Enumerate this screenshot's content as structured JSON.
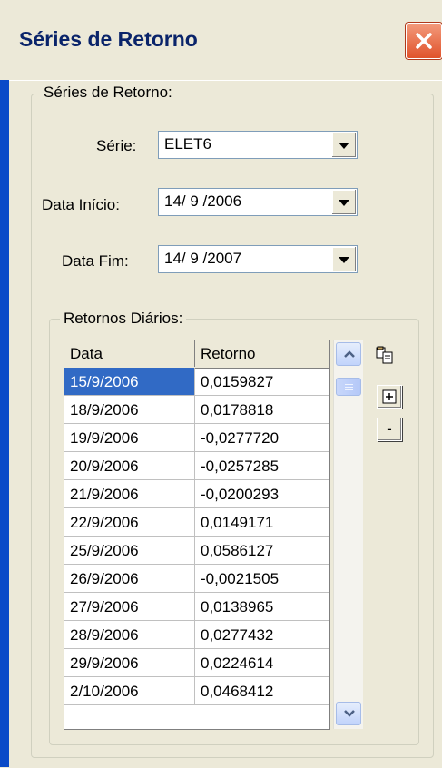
{
  "window": {
    "title": "Séries de Retorno"
  },
  "group_main": {
    "legend": "Séries de Retorno:"
  },
  "fields": {
    "serie": {
      "label": "Série:",
      "value": "ELET6"
    },
    "data_inicio": {
      "label": "Data Início:",
      "value": "14/ 9 /2006"
    },
    "data_fim": {
      "label": "Data Fim:",
      "value": "14/ 9 /2007"
    }
  },
  "group_returns": {
    "legend": "Retornos Diários:"
  },
  "table": {
    "columns": [
      "Data",
      "Retorno"
    ],
    "rows": [
      [
        "15/9/2006",
        "0,0159827"
      ],
      [
        "18/9/2006",
        "0,0178818"
      ],
      [
        "19/9/2006",
        "-0,0277720"
      ],
      [
        "20/9/2006",
        "-0,0257285"
      ],
      [
        "21/9/2006",
        "-0,0200293"
      ],
      [
        "22/9/2006",
        "0,0149171"
      ],
      [
        "25/9/2006",
        "0,0586127"
      ],
      [
        "26/9/2006",
        "-0,0021505"
      ],
      [
        "27/9/2006",
        "0,0138965"
      ],
      [
        "28/9/2006",
        "0,0277432"
      ],
      [
        "29/9/2006",
        "0,0224614"
      ],
      [
        "2/10/2006",
        "0,0468412"
      ]
    ],
    "selected_row": 0
  },
  "toolbar": {
    "copy": "copy-icon",
    "expand": "plus-box-icon",
    "minus_label": "-"
  },
  "colors": {
    "selection": "#316ac5",
    "window_frame": "#0a4ac8",
    "title_text": "#0a246a"
  }
}
